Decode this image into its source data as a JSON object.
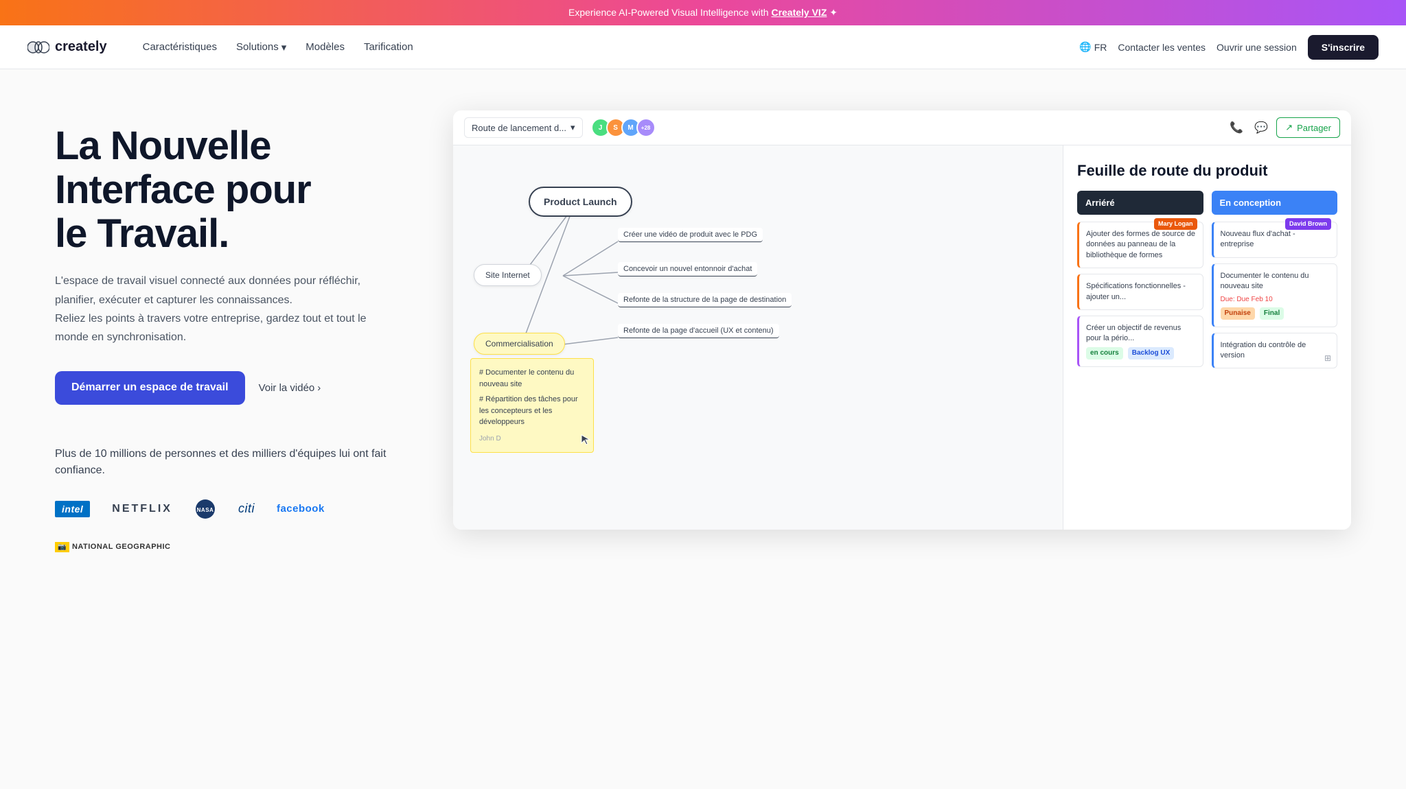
{
  "banner": {
    "text": "Experience AI-Powered Visual Intelligence with ",
    "link_text": "Creately VIZ",
    "star": "✦"
  },
  "nav": {
    "logo_text": "creately",
    "links": [
      {
        "label": "Caractéristiques",
        "has_arrow": false
      },
      {
        "label": "Solutions",
        "has_arrow": true
      },
      {
        "label": "Modèles",
        "has_arrow": false
      },
      {
        "label": "Tarification",
        "has_arrow": false
      }
    ],
    "lang": "FR",
    "contact_sales": "Contacter les ventes",
    "open_session": "Ouvrir une session",
    "signup": "S'inscrire"
  },
  "hero": {
    "title_line1": "La Nouvelle",
    "title_line2": "Interface pour",
    "title_line3": "le Travail.",
    "description": "L'espace de travail visuel connecté aux données pour réfléchir, planifier, exécuter et capturer les connaissances.\nReliez les points à travers votre entreprise, gardez tout et tout le monde en synchronisation.",
    "cta_primary": "Démarrer un espace de travail",
    "cta_video": "Voir la vidéo",
    "trust_text": "Plus de 10 millions de personnes et des milliers d'équipes lui ont fait confiance.",
    "logos": [
      "intel",
      "NETFLIX",
      "NASA",
      "citi",
      "facebook",
      "NATIONAL GEOGRAPHIC"
    ]
  },
  "app": {
    "toolbar": {
      "dropdown_label": "Route de lancement d...",
      "share_label": "Partager",
      "avatar_count": "+28"
    },
    "mindmap": {
      "central_node": "Product Launch",
      "nodes": [
        {
          "id": "site-internet",
          "label": "Site Internet"
        },
        {
          "id": "commercialisation",
          "label": "Commercialisation"
        }
      ],
      "branches": [
        {
          "id": "b1",
          "label": "Créer une vidéo de produit avec le PDG"
        },
        {
          "id": "b2",
          "label": "Concevoir un nouvel entonnoir d'achat"
        },
        {
          "id": "b3",
          "label": "Refonte de la structure de la page de destination"
        },
        {
          "id": "b4",
          "label": "Refonte de la page d'accueil (UX et contenu)"
        }
      ],
      "sticky": {
        "item1": "# Documenter le contenu du nouveau site",
        "item2": "# Répartition des tâches pour les concepteurs et les développeurs",
        "author": "John D"
      }
    },
    "roadmap": {
      "title": "Feuille de route du produit",
      "columns": [
        {
          "id": "arrieres",
          "header": "Arriéré",
          "cards": [
            {
              "text": "Ajouter des formes de source de données au panneau de la bibliothèque de formes",
              "border": "orange",
              "user": "Mary Logan",
              "user_color": "orange"
            },
            {
              "text": "Spécifications fonctionnelles - ajouter un...",
              "border": "orange"
            },
            {
              "text": "Créer un objectif de revenus pour la pério...",
              "border": "purple",
              "badges": [
                "en cours",
                "Backlog UX"
              ],
              "badge_colors": [
                "green",
                "blue"
              ]
            }
          ]
        },
        {
          "id": "en-conception",
          "header": "En conception",
          "cards": [
            {
              "text": "Nouveau flux d'achat - entreprise",
              "border": "blue",
              "user": "David Brown",
              "user_color": "purple"
            },
            {
              "text": "Documenter le contenu du nouveau site",
              "border": "blue",
              "due": "Due: Due Feb 10",
              "badges": [
                "Punaise",
                "Final"
              ],
              "badge_colors": [
                "orange",
                "green"
              ]
            },
            {
              "text": "Intégration du contrôle de version",
              "border": "blue",
              "has_icon": true
            }
          ]
        }
      ]
    }
  }
}
